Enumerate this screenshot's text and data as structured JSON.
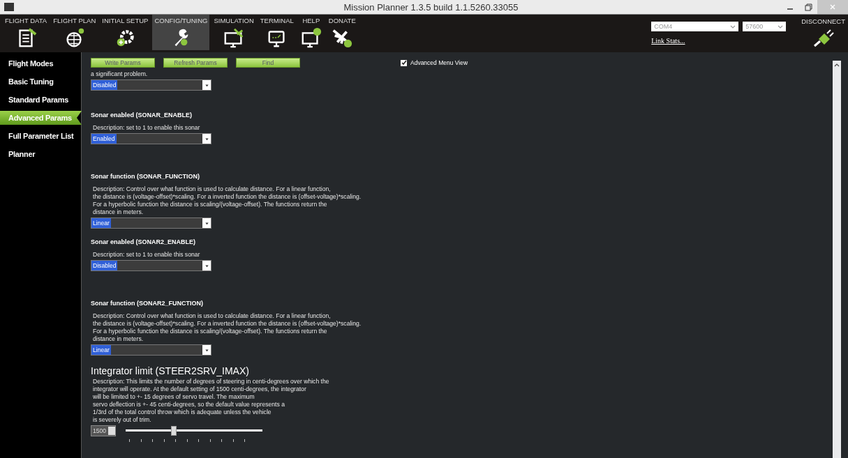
{
  "window": {
    "title": "Mission Planner 1.3.5 build 1.1.5260.33055"
  },
  "nav": [
    {
      "label": "FLIGHT DATA",
      "selected": false
    },
    {
      "label": "FLIGHT PLAN",
      "selected": false
    },
    {
      "label": "INITIAL SETUP",
      "selected": false
    },
    {
      "label": "CONFIG/TUNING",
      "selected": true
    },
    {
      "label": "SIMULATION",
      "selected": false
    },
    {
      "label": "TERMINAL",
      "selected": false
    },
    {
      "label": "HELP",
      "selected": false
    },
    {
      "label": "DONATE",
      "selected": false
    }
  ],
  "connection": {
    "port": "COM4",
    "baud": "57600",
    "link_stats": "Link Stats...",
    "disconnect": "DISCONNECT"
  },
  "sidebar": {
    "items": [
      {
        "label": "Flight Modes",
        "selected": false
      },
      {
        "label": "Basic Tuning",
        "selected": false
      },
      {
        "label": "Standard Params",
        "selected": false
      },
      {
        "label": "Advanced Params",
        "selected": true
      },
      {
        "label": "Full Parameter List",
        "selected": false
      },
      {
        "label": "Planner",
        "selected": false
      }
    ]
  },
  "toolbar": {
    "buttons": [
      "Write Params",
      "Refresh Params",
      "Find"
    ],
    "advanced_view": {
      "label": "Advanced Menu View",
      "checked": true
    }
  },
  "params": [
    {
      "kind": "tail",
      "description": "a significant problem.",
      "value": "Disabled"
    },
    {
      "kind": "select",
      "title": "Sonar enabled (SONAR_ENABLE)",
      "description": "Description: set to 1 to enable this sonar",
      "value": "Enabled"
    },
    {
      "kind": "select",
      "title": "Sonar function (SONAR_FUNCTION)",
      "description": "Description: Control over what function is used to calculate distance. For a linear function,\nthe distance is (voltage-offset)*scaling. For a inverted function the distance is (offset-voltage)*scaling.\nFor a hyperbolic function the distance is scaling/(voltage-offset). The functions return the\ndistance in meters.",
      "value": "Linear"
    },
    {
      "kind": "select",
      "title": "Sonar enabled (SONAR2_ENABLE)",
      "description": "Description: set to 1 to enable this sonar",
      "value": "Disabled"
    },
    {
      "kind": "select",
      "title": "Sonar function (SONAR2_FUNCTION)",
      "description": "Description: Control over what function is used to calculate distance. For a linear function,\nthe distance is (voltage-offset)*scaling. For a inverted function the distance is (offset-voltage)*scaling.\nFor a hyperbolic function the distance is scaling/(voltage-offset). The functions return the\ndistance in meters.",
      "value": "Linear"
    },
    {
      "kind": "slider",
      "title": "Integrator limit (STEER2SRV_IMAX)",
      "description": "Description: This limits the number of degrees of steering in centi-degrees over which the\nintegrator will operate. At the default setting of 1500 centi-degrees, the integrator\nwill be limited to +- 15 degrees of servo travel. The maximum\nservo deflection is +- 45 centi-degrees, so the default value represents a\n1/3rd of the total control throw which is adequate unless the vehicle\nis severely out of trim.",
      "value": "1500",
      "level": 0.35
    }
  ]
}
